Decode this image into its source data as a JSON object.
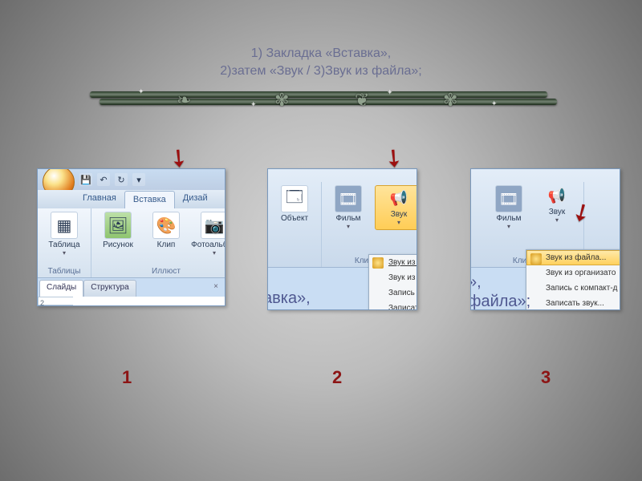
{
  "title": {
    "line1": "1) Закладка «Вставка»,",
    "line2": "2)затем  «Звук / 3)Звук из файла»;"
  },
  "shot1": {
    "tabs": {
      "home": "Главная",
      "insert": "Вставка",
      "design": "Дизай"
    },
    "ribbon": {
      "group_tables": "Таблицы",
      "table": "Таблица",
      "group_illust": "Иллюст",
      "picture": "Рисунок",
      "clip": "Клип",
      "album": "Фотоальбом"
    },
    "nav": {
      "slides": "Слайды",
      "outline": "Структура"
    },
    "thumb_index": "2"
  },
  "shot2": {
    "ribbon": {
      "object": "Объект",
      "movie": "Фильм",
      "sound": "Звук",
      "group_media": "Клипы мул"
    },
    "menu": [
      "Звук из ф",
      "Звук из о",
      "Запись с",
      "Записать"
    ],
    "doc_text": "авка»,"
  },
  "shot3": {
    "ribbon": {
      "movie": "Фильм",
      "sound": "Звук",
      "group_media": "Клипы мул"
    },
    "menu": [
      "Звук из файла...",
      "Звук из организато",
      "Запись с компакт-д",
      "Записать звук..."
    ],
    "doc_text1": "»,",
    "doc_text2": "файла»;"
  },
  "labels": {
    "n1": "1",
    "n2": "2",
    "n3": "3"
  }
}
